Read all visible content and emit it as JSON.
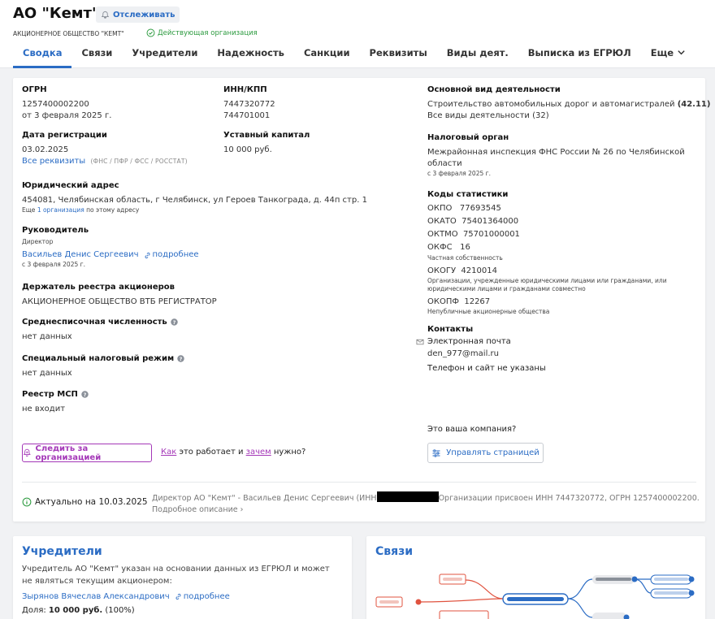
{
  "header": {
    "title": "АО \"Кемт\"",
    "track_label": "Отслеживать",
    "subtitle": "АКЦИОНЕРНОЕ ОБЩЕСТВО \"КЕМТ\"",
    "status": "Действующая организация",
    "tabs": [
      "Сводка",
      "Связи",
      "Учредители",
      "Надежность",
      "Санкции",
      "Реквизиты",
      "Виды деят.",
      "Выписка из ЕГРЮЛ",
      "Еще"
    ]
  },
  "summary": {
    "ogrn": {
      "label": "ОГРН",
      "value": "1257400002200",
      "date": "от 3 февраля 2025 г."
    },
    "inn": {
      "label": "ИНН/КПП",
      "inn": "7447320772",
      "kpp": "744701001"
    },
    "reg": {
      "label": "Дата регистрации",
      "value": "03.02.2025",
      "link": "Все реквизиты",
      "note": "(ФНС / ПФР / ФСС / РОССТАТ)"
    },
    "capital": {
      "label": "Уставный капитал",
      "value": "10 000 руб."
    },
    "address": {
      "label": "Юридический адрес",
      "value": "454081, Челябинская область, г Челябинск, ул Героев Танкограда, д. 44п стр. 1",
      "more_prefix": "Еще",
      "more_link": "1 организация",
      "more_suffix": "по этому адресу"
    },
    "head": {
      "label": "Руководитель",
      "role": "Директор",
      "name": "Васильев Денис Сергеевич",
      "details": "подробнее",
      "since": "с 3 февраля 2025 г."
    },
    "registry": {
      "label": "Держатель реестра акционеров",
      "value": "АКЦИОНЕРНОЕ ОБЩЕСТВО ВТБ РЕГИСТРАТОР"
    },
    "headcount": {
      "label": "Среднесписочная численность",
      "value": "нет данных"
    },
    "tax": {
      "label": "Специальный налоговый режим",
      "value": "нет данных"
    },
    "msp": {
      "label": "Реестр МСП",
      "value": "не входит"
    },
    "activity": {
      "label": "Основной вид деятельности",
      "value": "Строительство автомобильных дорог и автомагистралей",
      "code": "(42.11)",
      "link": "Все виды деятельности",
      "count": "(32)"
    },
    "tax_office": {
      "label": "Налоговый орган",
      "line1": "Межрайонная инспекция ФНС России № 26 по Челябинской",
      "line2": "области",
      "since": "с 3 февраля 2025 г."
    },
    "stats": {
      "label": "Коды статистики",
      "okpo_k": "ОКПО",
      "okpo": "77693545",
      "okato_k": "ОКАТО",
      "okato": "75401364000",
      "oktmo_k": "ОКТМО",
      "oktmo": "75701000001",
      "okfs_k": "ОКФС",
      "okfs": "16",
      "okfs_note": "Частная собственность",
      "okogu_k": "ОКОГУ",
      "okogu": "4210014",
      "okogu_note1": "Организации, учрежденные юридическими лицами или гражданами, или",
      "okogu_note2": "юридическими лицами и гражданами совместно",
      "okopf_k": "ОКОПФ",
      "okopf": "12267",
      "okopf_note": "Непубличные акционерные общества"
    },
    "contacts": {
      "label": "Контакты",
      "email_label": "Электронная почта",
      "email": "den_977@mail.ru",
      "phone": "Телефон и сайт не указаны"
    },
    "follow_btn": "Следить за организацией",
    "how": {
      "link1": "Как",
      "mid": "это работает и",
      "link2": "зачем",
      "end": "нужно?"
    },
    "your_company": "Это ваша компания?",
    "manage_btn": "Управлять страницей",
    "actual": "Актуально на 10.03.2025",
    "desc_1": "Директор АО \"Кемт\" - Васильев Денис Сергеевич (ИНН",
    "desc_2": "Организации присвоен ИНН 7447320772, ОГРН 1257400002200.",
    "desc_link": "Подробное описание ›"
  },
  "founders": {
    "title": "Учредители",
    "text": "Учредитель АО \"Кемт\" указан на основании данных из ЕГРЮЛ и может не являться текущим акционером:",
    "name": "Зырянов Вячеслав Александрович",
    "details": "подробнее",
    "share_label": "Доля:",
    "share_value": "10 000 руб.",
    "share_pct": "(100%)"
  },
  "links": {
    "title": "Связи"
  },
  "colors": {
    "accent": "#2b6cc4",
    "follow": "#a438b8",
    "ok": "#2b9a3e",
    "graph_red": "#e0533f"
  }
}
